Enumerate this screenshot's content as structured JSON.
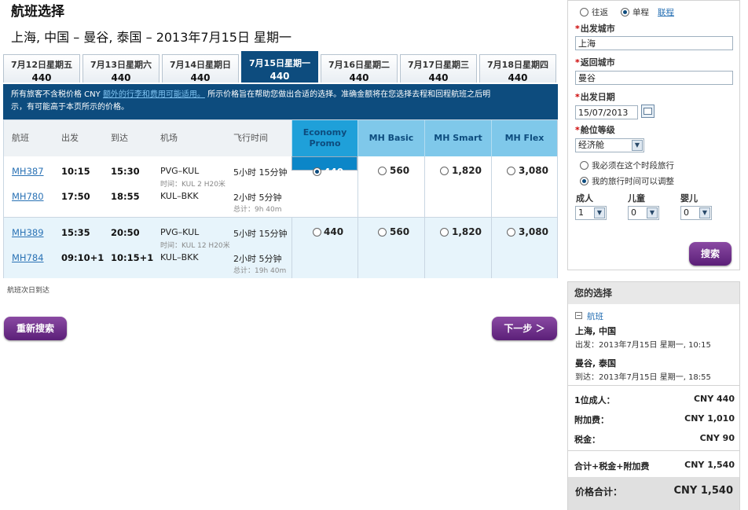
{
  "page": {
    "title": "航班选择",
    "route": "上海, 中国 – 曼谷, 泰国 – 2013年7月15日 星期一"
  },
  "date_tabs": [
    {
      "label": "7月12日星期五",
      "price": "440"
    },
    {
      "label": "7月13日星期六",
      "price": "440"
    },
    {
      "label": "7月14日星期日",
      "price": "440"
    },
    {
      "label": "7月15日星期一",
      "price": "440",
      "active": true
    },
    {
      "label": "7月16日星期二",
      "price": "440"
    },
    {
      "label": "7月17日星期三",
      "price": "440"
    },
    {
      "label": "7月18日星期四",
      "price": "440"
    }
  ],
  "notice": {
    "text1": "所有旅客不含税价格 CNY ",
    "link": "额外的行李和费用可能适用。",
    "text2": " 所示价格旨在帮助您做出合适的选择。准确金额将在您选择去程和回程航班之后明",
    "text3": "示，有可能高于本页所示的价格。"
  },
  "table": {
    "headers": {
      "flight": "航班",
      "depart": "出发",
      "arrive": "到达",
      "airport": "机场",
      "duration": "飞行时间"
    },
    "fare_headers": [
      {
        "line1": "Economy",
        "line2": "Promo"
      },
      {
        "line1": "MH Basic"
      },
      {
        "line1": "MH Smart"
      },
      {
        "line1": "MH Flex"
      }
    ],
    "rows": [
      {
        "legs": [
          {
            "flight": "MH387",
            "depart": "10:15",
            "arrive": "15:30",
            "airports": "PVG–KUL",
            "duration": "5小时 15分钟",
            "stopover": "时间：KUL 2 H20米"
          },
          {
            "flight": "MH780",
            "depart": "17:50",
            "arrive": "18:55",
            "airports": "KUL–BKK",
            "duration": "2小时 5分钟",
            "total": "总计：9h 40m"
          }
        ],
        "fares": [
          "440",
          "560",
          "1,820",
          "3,080"
        ],
        "selected": 0
      },
      {
        "legs": [
          {
            "flight": "MH389",
            "depart": "15:35",
            "arrive": "20:50",
            "airports": "PVG–KUL",
            "duration": "5小时 15分钟",
            "stopover": "时间：KUL 12 H20米"
          },
          {
            "flight": "MH784",
            "depart": "09:10+1",
            "arrive": "10:15+1",
            "airports": "KUL–BKK",
            "duration": "2小时 5分钟",
            "total": "总计：19h 40m"
          }
        ],
        "fares": [
          "440",
          "560",
          "1,820",
          "3,080"
        ],
        "selected": -1
      }
    ]
  },
  "next_day_note": "航班次日到达",
  "buttons": {
    "research": "重新搜索",
    "next": "下一步 ＞"
  },
  "search": {
    "trip_round": "往返",
    "trip_oneway": "单程",
    "multi_link": "联程",
    "origin_label": "出发城市",
    "origin_value": "上海",
    "dest_label": "返回城市",
    "dest_value": "曼谷",
    "date_label": "出发日期",
    "date_value": "15/07/2013",
    "cabin_label": "舱位等级",
    "cabin_value": "经济舱",
    "opt_fixed": "我必须在这个时段旅行",
    "opt_flexible": "我的旅行时间可以调整",
    "adult_label": "成人",
    "child_label": "儿童",
    "infant_label": "婴儿",
    "adult_value": "1",
    "child_value": "0",
    "infant_value": "0",
    "search_button": "搜索"
  },
  "summary": {
    "heading": "您的选择",
    "section": "航班",
    "origin_city": "上海, 中国",
    "depart_line": "出发：2013年7月15日 星期一, 10:15",
    "dest_city": "曼谷, 泰国",
    "arrive_line": "到达：2013年7月15日 星期一, 18:55",
    "rows": [
      {
        "label": "1位成人：",
        "value": "CNY 440"
      },
      {
        "label": "附加费：",
        "value": "CNY 1,010"
      },
      {
        "label": "税金：",
        "value": "CNY 90"
      }
    ],
    "subtotal_label": "合计+税金+附加费",
    "subtotal_value": "CNY 1,540",
    "total_label": "价格合计：",
    "total_value": "CNY 1,540"
  }
}
